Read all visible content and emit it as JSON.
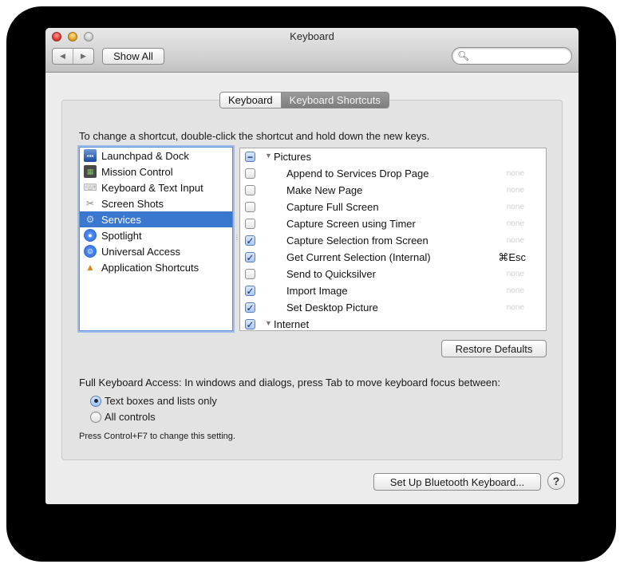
{
  "window": {
    "title": "Keyboard"
  },
  "toolbar": {
    "back_icon": "back-arrow-icon",
    "forward_icon": "forward-arrow-icon",
    "show_all_label": "Show All",
    "search_placeholder": "",
    "search_icon": "search-icon"
  },
  "tabs": [
    {
      "label": "Keyboard",
      "active": false
    },
    {
      "label": "Keyboard Shortcuts",
      "active": true
    }
  ],
  "instruction": "To change a shortcut, double-click the shortcut and hold down the new keys.",
  "categories": [
    {
      "label": "Launchpad & Dock",
      "icon": "launchpad-icon",
      "selected": false
    },
    {
      "label": "Mission Control",
      "icon": "mission-control-icon",
      "selected": false
    },
    {
      "label": "Keyboard & Text Input",
      "icon": "keyboard-icon",
      "selected": false
    },
    {
      "label": "Screen Shots",
      "icon": "screenshot-icon",
      "selected": false
    },
    {
      "label": "Services",
      "icon": "gear-icon",
      "selected": true
    },
    {
      "label": "Spotlight",
      "icon": "spotlight-icon",
      "selected": false
    },
    {
      "label": "Universal Access",
      "icon": "universal-access-icon",
      "selected": false
    },
    {
      "label": "Application Shortcuts",
      "icon": "app-shortcuts-icon",
      "selected": false
    }
  ],
  "shortcuts": {
    "groups": [
      {
        "label": "Pictures",
        "state": "mixed",
        "expanded": true,
        "items": [
          {
            "label": "Append to Services Drop Page",
            "checked": false,
            "shortcut": "none"
          },
          {
            "label": "Make New Page",
            "checked": false,
            "shortcut": "none"
          },
          {
            "label": "Capture Full Screen",
            "checked": false,
            "shortcut": "none"
          },
          {
            "label": "Capture Screen using Timer",
            "checked": false,
            "shortcut": "none"
          },
          {
            "label": "Capture Selection from Screen",
            "checked": true,
            "shortcut": "none"
          },
          {
            "label": "Get Current Selection (Internal)",
            "checked": true,
            "shortcut": "⌘Esc"
          },
          {
            "label": "Send to Quicksilver",
            "checked": false,
            "shortcut": "none"
          },
          {
            "label": "Import Image",
            "checked": true,
            "shortcut": "none"
          },
          {
            "label": "Set Desktop Picture",
            "checked": true,
            "shortcut": "none"
          }
        ]
      },
      {
        "label": "Internet",
        "state": "checked",
        "expanded": true,
        "items": []
      }
    ]
  },
  "restore_defaults_label": "Restore Defaults",
  "full_keyboard_access": {
    "label": "Full Keyboard Access: In windows and dialogs, press Tab to move keyboard focus between:",
    "options": [
      {
        "label": "Text boxes and lists only",
        "selected": true
      },
      {
        "label": "All controls",
        "selected": false
      }
    ],
    "hint": "Press Control+F7 to change this setting."
  },
  "bluetooth_button_label": "Set Up Bluetooth Keyboard...",
  "help_label": "?",
  "colors": {
    "selection": "#3a78d0",
    "window_bg": "#ececec"
  }
}
